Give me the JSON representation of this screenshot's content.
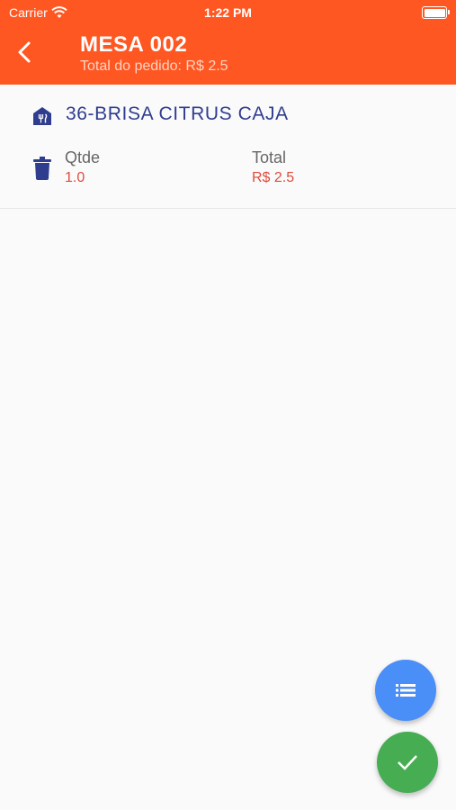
{
  "status_bar": {
    "carrier": "Carrier",
    "time": "1:22 PM"
  },
  "header": {
    "title": "MESA 002",
    "subtitle": "Total do pedido: R$ 2.5"
  },
  "order_item": {
    "product": "36-BRISA CITRUS CAJA",
    "qtde_label": "Qtde",
    "qtde_value": "1.0",
    "total_label": "Total",
    "total_value": "R$ 2.5"
  },
  "fabs": {
    "list_icon": "list-icon",
    "confirm_icon": "check-icon"
  },
  "colors": {
    "appbar": "#ff5722",
    "primary_text": "#2f3d8e",
    "value_red": "#e04b3c",
    "fab_blue": "#4a8ef7",
    "fab_green": "#46ad52"
  }
}
